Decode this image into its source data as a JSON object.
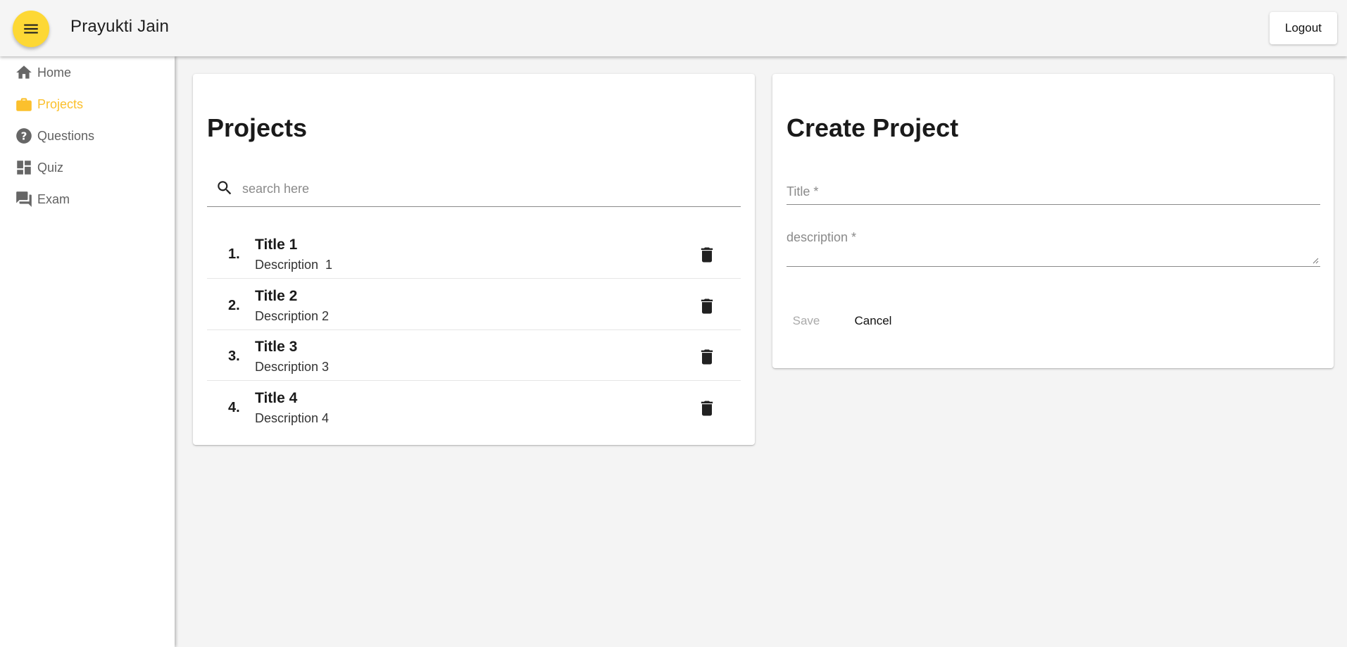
{
  "header": {
    "title": "Prayukti Jain",
    "menu_icon": "menu-icon",
    "logout_label": "Logout"
  },
  "colors": {
    "accent": "#fdd835",
    "active_nav": "#fbc02d"
  },
  "sidebar": {
    "items": [
      {
        "label": "Home",
        "icon": "home-icon",
        "active": false
      },
      {
        "label": "Projects",
        "icon": "briefcase-icon",
        "active": true
      },
      {
        "label": "Questions",
        "icon": "help-circle-icon",
        "active": false
      },
      {
        "label": "Quiz",
        "icon": "dashboard-icon",
        "active": false
      },
      {
        "label": "Exam",
        "icon": "forum-icon",
        "active": false
      }
    ]
  },
  "projects": {
    "heading": "Projects",
    "search_placeholder": "search here",
    "items": [
      {
        "num": "1.",
        "title": "Title 1",
        "description": "Description  1"
      },
      {
        "num": "2.",
        "title": "Title 2",
        "description": "Description 2"
      },
      {
        "num": "3.",
        "title": "Title 3",
        "description": "Description 3"
      },
      {
        "num": "4.",
        "title": "Title 4",
        "description": "Description 4"
      }
    ]
  },
  "create": {
    "heading": "Create Project",
    "title_placeholder": "Title *",
    "description_placeholder": "description *",
    "save_label": "Save",
    "cancel_label": "Cancel"
  }
}
